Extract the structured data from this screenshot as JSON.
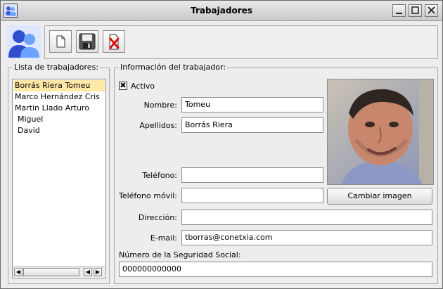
{
  "window": {
    "title": "Trabajadores"
  },
  "list_section": {
    "label": "Lista de trabajadores:",
    "items": [
      "Borrás Riera Tomeu",
      "Marco Hernández Cris",
      "Martin Llado Arturo",
      "Miguel",
      "David"
    ]
  },
  "info_section": {
    "label": "Información del trabajador:",
    "active_label": "Activo",
    "active_checked": true,
    "nombre_label": "Nombre:",
    "nombre_value": "Tomeu",
    "apellidos_label": "Apellidos:",
    "apellidos_value": "Borrás Riera",
    "telefono_label": "Teléfono:",
    "telefono_value": "",
    "movil_label": "Teléfono móvil:",
    "movil_value": "",
    "direccion_label": "Dirección:",
    "direccion_value": "",
    "email_label": "E-mail:",
    "email_value": "tborras@conetxia.com",
    "ss_label": "Número de la Seguridad Social:",
    "ss_value": "000000000000",
    "change_image_label": "Cambiar imagen"
  },
  "icons": {
    "new": "new-document-icon",
    "save": "floppy-disk-icon",
    "delete": "delete-document-icon",
    "app": "users-icon"
  },
  "colors": {
    "selection": "#ffe8a8",
    "accent": "#3a5bd9"
  }
}
